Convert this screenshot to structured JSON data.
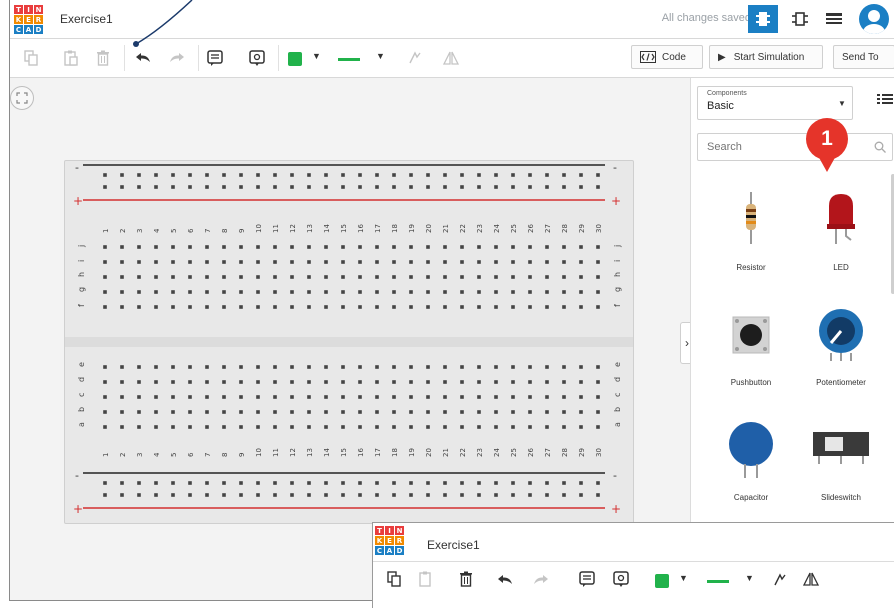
{
  "app": {
    "logo_letters": [
      "T",
      "I",
      "N",
      "K",
      "E",
      "R",
      "C",
      "A",
      "D"
    ],
    "logo_colors": [
      "#e93d3d",
      "#e93d3d",
      "#e93d3d",
      "#f18a00",
      "#f18a00",
      "#f18a00",
      "#1b7fc4",
      "#1b7fc4",
      "#1b7fc4"
    ],
    "project_title": "Exercise1",
    "save_status": "All changes saved",
    "avatar_color": "#1b7fc4"
  },
  "toolbar": {
    "code_label": "Code",
    "start_simulation_label": "Start Simulation",
    "send_to_label": "Send To",
    "fill_color": "#21b24b",
    "line_color": "#21b24b"
  },
  "breadboard": {
    "column_numbers": [
      "1",
      "2",
      "3",
      "4",
      "5",
      "6",
      "7",
      "8",
      "9",
      "10",
      "11",
      "12",
      "13",
      "14",
      "15",
      "16",
      "17",
      "18",
      "19",
      "20",
      "21",
      "22",
      "23",
      "24",
      "25",
      "26",
      "27",
      "28",
      "29",
      "30"
    ],
    "top_rows": [
      "j",
      "i",
      "h",
      "g",
      "f"
    ],
    "bottom_rows": [
      "e",
      "d",
      "c",
      "b",
      "a"
    ],
    "rail_minus": "-",
    "rail_plus": "+"
  },
  "components_panel": {
    "dropdown_caption": "Components",
    "dropdown_value": "Basic",
    "search_placeholder": "Search",
    "items": [
      {
        "label": "Resistor",
        "icon": "resistor-icon"
      },
      {
        "label": "LED",
        "icon": "led-icon"
      },
      {
        "label": "Pushbutton",
        "icon": "pushbutton-icon"
      },
      {
        "label": "Potentiometer",
        "icon": "potentiometer-icon"
      },
      {
        "label": "Capacitor",
        "icon": "capacitor-icon"
      },
      {
        "label": "Slideswitch",
        "icon": "slideswitch-icon"
      }
    ]
  },
  "annotation": {
    "marker_number": "1"
  },
  "overlay": {
    "project_title": "Exercise1"
  }
}
